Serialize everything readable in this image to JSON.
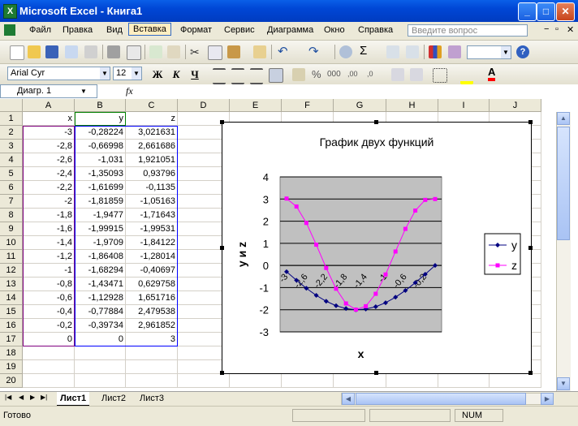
{
  "window": {
    "title": "Microsoft Excel - Книга1",
    "app_icon_glyph": "X"
  },
  "menu": {
    "items": [
      "Файл",
      "Правка",
      "Вид",
      "Вставка",
      "Формат",
      "Сервис",
      "Диаграмма",
      "Окно",
      "Справка"
    ],
    "help_placeholder": "Введите вопрос"
  },
  "format_toolbar": {
    "font": "Arial Cyr",
    "size": "12",
    "bold": "Ж",
    "italic": "К",
    "underline": "Ч"
  },
  "formula_bar": {
    "name_box": "Диагр. 1",
    "fx": "fx",
    "value": ""
  },
  "columns": [
    "A",
    "B",
    "C",
    "D",
    "E",
    "F",
    "G",
    "H",
    "I",
    "J"
  ],
  "rows": [
    "1",
    "2",
    "3",
    "4",
    "5",
    "6",
    "7",
    "8",
    "9",
    "10",
    "11",
    "12",
    "13",
    "14",
    "15",
    "16",
    "17",
    "18",
    "19",
    "20"
  ],
  "cells": {
    "headers": [
      "x",
      "y",
      "z"
    ],
    "data": [
      [
        "-3",
        "-0,28224",
        "3,021631"
      ],
      [
        "-2,8",
        "-0,66998",
        "2,661686"
      ],
      [
        "-2,6",
        "-1,031",
        "1,921051"
      ],
      [
        "-2,4",
        "-1,35093",
        "0,93796"
      ],
      [
        "-2,2",
        "-1,61699",
        "-0,1135"
      ],
      [
        "-2",
        "-1,81859",
        "-1,05163"
      ],
      [
        "-1,8",
        "-1,9477",
        "-1,71643"
      ],
      [
        "-1,6",
        "-1,99915",
        "-1,99531"
      ],
      [
        "-1,4",
        "-1,9709",
        "-1,84122"
      ],
      [
        "-1,2",
        "-1,86408",
        "-1,28014"
      ],
      [
        "-1",
        "-1,68294",
        "-0,40697"
      ],
      [
        "-0,8",
        "-1,43471",
        "0,629758"
      ],
      [
        "-0,6",
        "-1,12928",
        "1,651716"
      ],
      [
        "-0,4",
        "-0,77884",
        "2,479538"
      ],
      [
        "-0,2",
        "-0,39734",
        "2,961852"
      ],
      [
        "0",
        "0",
        "3"
      ]
    ]
  },
  "sheets": {
    "tabs": [
      "Лист1",
      "Лист2",
      "Лист3"
    ],
    "active": "Лист1"
  },
  "status": {
    "left": "Готово",
    "num": "NUM"
  },
  "chart_data": {
    "type": "line",
    "title": "График двух функций",
    "xlabel": "x",
    "ylabel": "y и z",
    "categories": [
      "-3",
      "-2,8",
      "-2,6",
      "-2,4",
      "-2,2",
      "-2",
      "-1,8",
      "-1,6",
      "-1,4",
      "-1,2",
      "-1",
      "-0,8",
      "-0,6",
      "-0,4",
      "-0,2",
      "0"
    ],
    "x_tick_labels": [
      "-3",
      "-2,6",
      "-2,2",
      "-1,8",
      "-1,4",
      "-1",
      "-0,6",
      "-0,2"
    ],
    "ylim": [
      -3,
      4
    ],
    "yticks": [
      "4",
      "3",
      "2",
      "1",
      "0",
      "-1",
      "-2",
      "-3"
    ],
    "grid": true,
    "legend": "right",
    "series": [
      {
        "name": "y",
        "color": "#000080",
        "marker": "diamond",
        "values": [
          -0.28224,
          -0.66998,
          -1.031,
          -1.35093,
          -1.61699,
          -1.81859,
          -1.9477,
          -1.99915,
          -1.9709,
          -1.86408,
          -1.68294,
          -1.43471,
          -1.12928,
          -0.77884,
          -0.39734,
          0
        ]
      },
      {
        "name": "z",
        "color": "#FF00FF",
        "marker": "square",
        "values": [
          3.021631,
          2.661686,
          1.921051,
          0.93796,
          -0.1135,
          -1.05163,
          -1.71643,
          -1.99531,
          -1.84122,
          -1.28014,
          -0.40697,
          0.629758,
          1.651716,
          2.479538,
          2.961852,
          3
        ]
      }
    ]
  }
}
